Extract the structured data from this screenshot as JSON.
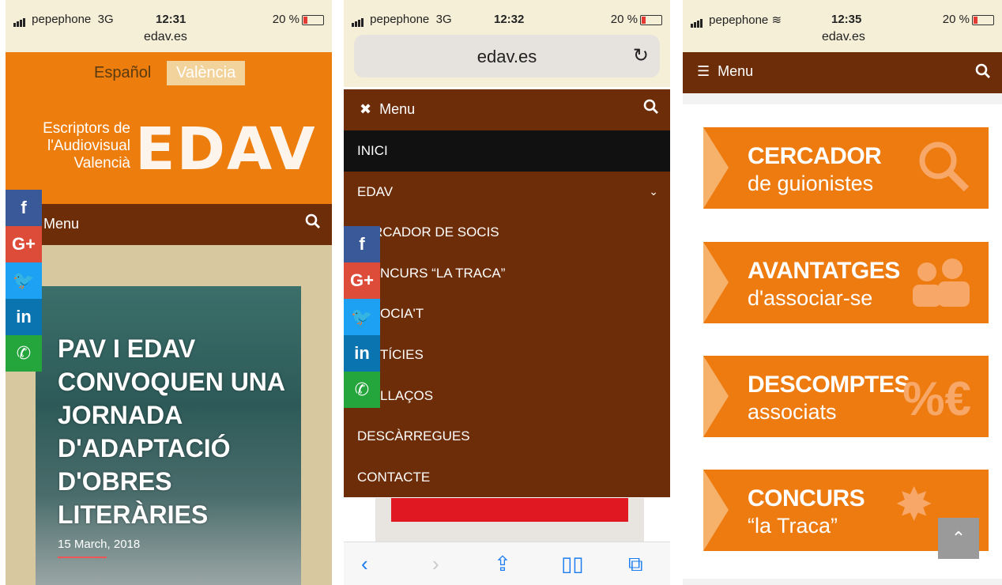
{
  "screens": [
    {
      "status": {
        "carrier": "pepephone",
        "network": "3G",
        "time": "12:31",
        "url": "edav.es",
        "battery": "20 %"
      },
      "languages": [
        "Español",
        "València"
      ],
      "logo": {
        "line1": "Escriptors de",
        "line2": "l'Audiovisual",
        "line3": "Valencià",
        "mark": "EDAV"
      },
      "menu_label": "Menu",
      "article": {
        "title": "PAV I EDAV CONVOQUEN UNA JORNADA D'ADAPTACIÓ D'OBRES LITERÀRIES",
        "date": "15 March, 2018"
      }
    },
    {
      "status": {
        "carrier": "pepephone",
        "network": "3G",
        "time": "12:32",
        "battery": "20 %"
      },
      "address": "edav.es",
      "menu_label": "Menu",
      "nav": [
        "INICI",
        "EDAV",
        "CERCADOR DE SOCIS",
        "CONCURS “LA TRACA”",
        "ASSOCIA'T",
        "NOTÍCIES",
        "ENLLAÇOS",
        "DESCÀRREGUES",
        "CONTACTE"
      ],
      "nav_visible": [
        "INICI",
        "EDAV",
        "RCADOR DE SOCIS",
        "NCURS “LA TRACA”",
        "OCIA'T",
        "TÍCIES",
        "LLAÇOS",
        "DESCÀRREGUES",
        "CONTACTE"
      ]
    },
    {
      "status": {
        "carrier": "pepephone",
        "time": "12:35",
        "url": "edav.es",
        "battery": "20 %"
      },
      "menu_label": "Menu",
      "banners": [
        {
          "title": "CERCADOR",
          "subtitle": "de guionistes",
          "icon": "search-icon"
        },
        {
          "title": "AVANTATGES",
          "subtitle": "d'associar-se",
          "icon": "people-icon"
        },
        {
          "title": "DESCOMPTES",
          "subtitle": "associats",
          "icon": "percent-euro-icon"
        },
        {
          "title": "CONCURS",
          "subtitle": "“la Traca”",
          "icon": "firework-icon"
        }
      ]
    }
  ],
  "social": [
    "f",
    "G+",
    "twitter",
    "in",
    "whatsapp"
  ],
  "colors": {
    "orange": "#ed7d0c",
    "brown": "#6d2d08",
    "sand": "#d8c8a0"
  }
}
